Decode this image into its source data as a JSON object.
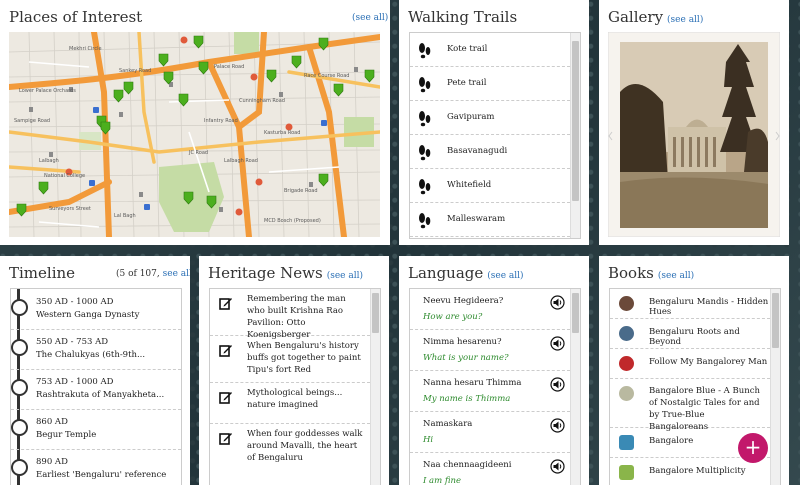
{
  "places": {
    "title": "Places of Interest",
    "see_all": "(see all)",
    "map_labels": [
      "Mekhri Circle",
      "Sankey Road",
      "Palace Road",
      "Race Course Road",
      "Lower Palace Orchards",
      "Cunningham Road",
      "Infantry Road",
      "Kasturba Road",
      "JC Road",
      "Lalbagh",
      "Lalbagh Road",
      "Surveyors Street",
      "National College",
      "MCD Bosch (Proposed)",
      "Lal Bagh",
      "Brigade Road",
      "Sampige Road"
    ]
  },
  "trails": {
    "title": "Walking Trails",
    "items": [
      "Kote trail",
      "Pete trail",
      "Gavipuram",
      "Basavanagudi",
      "Whitefield",
      "Malleswaram"
    ]
  },
  "gallery": {
    "title": "Gallery",
    "see_all": "(see all)"
  },
  "timeline": {
    "title": "Timeline",
    "count": "(5 of 107,",
    "see_all": "see all)",
    "items": [
      {
        "date": "350 AD - 1000 AD",
        "text": "Western Ganga Dynasty"
      },
      {
        "date": "550 AD - 753 AD",
        "text": "The Chalukyas (6th-9th..."
      },
      {
        "date": "753 AD - 1000 AD",
        "text": "Rashtrakuta of Manyakheta..."
      },
      {
        "date": "860 AD",
        "text": "Begur Temple"
      },
      {
        "date": "890 AD",
        "text": "Earliest 'Bengaluru' reference"
      }
    ]
  },
  "news": {
    "title": "Heritage News",
    "see_all": "(see all)",
    "items": [
      "Remembering the man who built Krishna Rao Pavilion: Otto Koenigsberger",
      "When Bengaluru's history buffs got together to paint Tipu's fort Red",
      "Mythological beings... nature imagined",
      "When four goddesses walk around Mavalli, the heart of Bengaluru"
    ]
  },
  "language": {
    "title": "Language",
    "see_all": "(see all)",
    "items": [
      {
        "phrase": "Neevu Hegideera?",
        "meaning": "How are you?"
      },
      {
        "phrase": "Nimma hesarenu?",
        "meaning": "What is your name?"
      },
      {
        "phrase": "Nanna hesaru Thimma",
        "meaning": "My name is Thimma"
      },
      {
        "phrase": "Namaskara",
        "meaning": "Hi"
      },
      {
        "phrase": "Naa chennaagideeni",
        "meaning": "I am fine"
      }
    ]
  },
  "books": {
    "title": "Books",
    "see_all": "(see all)",
    "items": [
      {
        "title": "Bengaluru Mandis - Hidden Hues",
        "color": "#6b4a3a"
      },
      {
        "title": "Bengaluru  Roots and Beyond",
        "color": "#4a6b8a"
      },
      {
        "title": "Follow My Bangalorey Man",
        "color": "#c0292b"
      },
      {
        "title": "Bangalore Blue - A Bunch of Nostalgic Tales for and by True-Blue Bangaloreans",
        "color": "#b9b9a0"
      },
      {
        "title": "Bangalore",
        "color": "#3a8ab5"
      },
      {
        "title": "Bangalore Multiplicity",
        "color": "#8ab54a"
      }
    ],
    "add_label": "+"
  },
  "colors": {
    "accent_link": "#2a6fb5",
    "fab": "#c2186b",
    "language_green": "#2e8b2e"
  }
}
